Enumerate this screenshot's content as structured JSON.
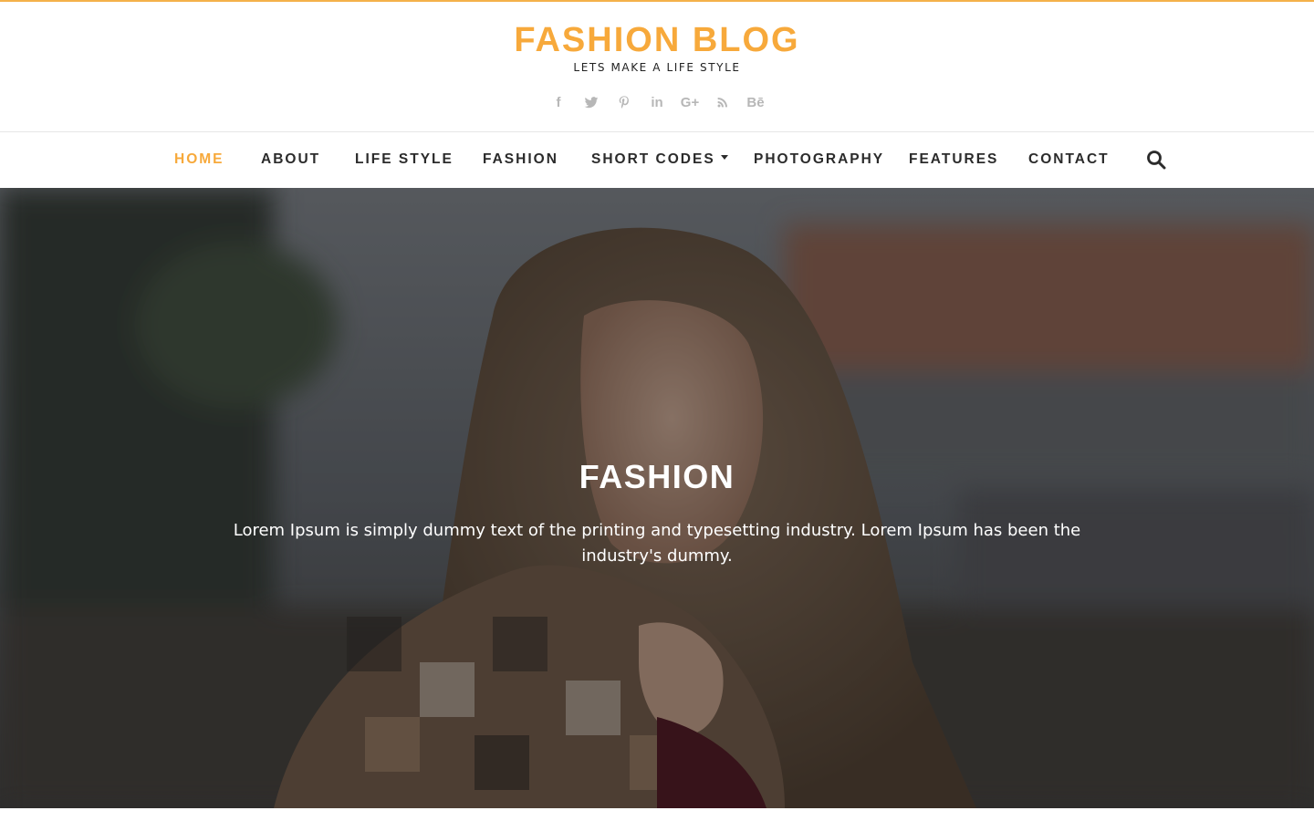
{
  "colors": {
    "accent": "#f7a93b",
    "nav_text": "#2b2b2b",
    "social_icon": "#b7b7b7",
    "hero_text": "#ffffff"
  },
  "header": {
    "title": "FASHION BLOG",
    "tagline": "LETS MAKE A LIFE STYLE",
    "social": [
      {
        "icon": "facebook-icon",
        "glyph": "f"
      },
      {
        "icon": "twitter-icon",
        "glyph": ""
      },
      {
        "icon": "pinterest-icon",
        "glyph": ""
      },
      {
        "icon": "linkedin-icon",
        "glyph": "in"
      },
      {
        "icon": "google-plus-icon",
        "glyph": "G+"
      },
      {
        "icon": "rss-icon",
        "glyph": ""
      },
      {
        "icon": "behance-icon",
        "glyph": "Bē"
      }
    ]
  },
  "nav": {
    "items": [
      {
        "label": "HOME",
        "active": true
      },
      {
        "label": "ABOUT",
        "active": false
      },
      {
        "label": "LIFE STYLE",
        "active": false
      },
      {
        "label": "FASHION",
        "active": false
      },
      {
        "label": "SHORT CODES",
        "active": false,
        "dropdown": true
      },
      {
        "label": "PHOTOGRAPHY",
        "active": false
      },
      {
        "label": "FEATURES",
        "active": false
      },
      {
        "label": "CONTACT",
        "active": false
      }
    ],
    "search_icon": "search-icon"
  },
  "hero": {
    "title": "FASHION",
    "text": "Lorem Ipsum is simply dummy text of the printing and typesetting industry. Lorem Ipsum has been the industry's dummy."
  }
}
